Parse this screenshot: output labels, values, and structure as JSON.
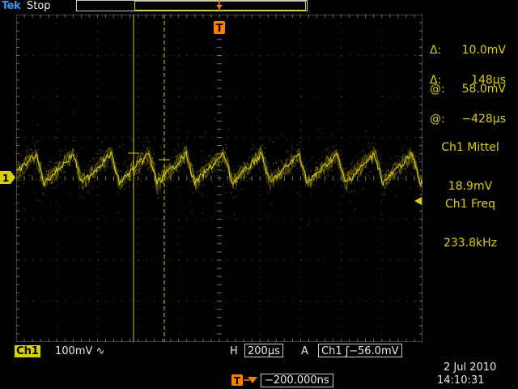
{
  "header": {
    "brand_main": "Tek",
    "status": "Stop"
  },
  "cursors": {
    "voltage": {
      "delta_symbol": "Δ:",
      "delta_value": "10.0mV",
      "at_symbol": "@:",
      "at_value": "58.0mV"
    },
    "time": {
      "delta_symbol": "Δ:",
      "delta_value": "148µs",
      "at_symbol": "@:",
      "at_value": "−428µs"
    }
  },
  "measurements": [
    {
      "name": "Ch1 Mittel",
      "value": "18.9mV"
    },
    {
      "name": "Ch1 Freq",
      "value": "233.8kHz"
    }
  ],
  "channel": {
    "badge": "Ch1",
    "marker": "1",
    "scale": "100mV",
    "coupling_symbol": "∿",
    "color": "#d8d000"
  },
  "horizontal": {
    "label": "H",
    "value": "200µs"
  },
  "trigger": {
    "label": "A",
    "source": "Ch1",
    "slope_symbol": "ʃ",
    "level": "−56.0mV",
    "marker": "T",
    "color": "#ff7f00"
  },
  "delay": {
    "value": "−200.000ns"
  },
  "datetime": {
    "date": "2 Jul  2010",
    "time": "14:10:31"
  }
}
